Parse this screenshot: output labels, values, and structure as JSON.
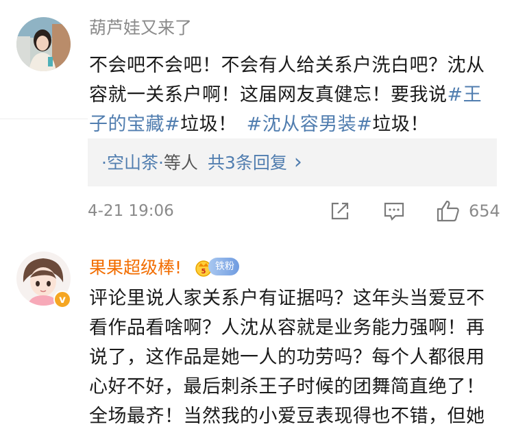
{
  "comments": [
    {
      "username": "葫芦娃又来了",
      "text_parts": [
        {
          "text": "不会吧不会吧！不会有人给关系户洗白吧？沈从容就一关系户啊！这届网友真健忘！要我说",
          "tag": false
        },
        {
          "text": "#王子的宝藏#",
          "tag": true
        },
        {
          "text": "垃圾！",
          "tag": false
        },
        {
          "text": "#沈从容男装#",
          "tag": true
        },
        {
          "text": "垃圾！",
          "tag": false
        }
      ],
      "replies": {
        "prefix": "·空山茶·",
        "middle": "等人",
        "link": "共3条回复",
        "chevron": "›"
      },
      "date": "4-21 19:06",
      "like_count": "654"
    },
    {
      "username": "果果超级棒!",
      "badge_label": "铁粉",
      "verified_mark": "v",
      "text": "评论里说人家关系户有证据吗？这年头当爱豆不看作品看啥啊？人沈从容就是业务能力强啊！再说了，这作品是她一人的功劳吗？每个人都很用心好不好，最后刺杀王子时候的团舞简直绝了！全场最齐！当然我的小爱豆表现得也不错，但她"
    }
  ],
  "icons": {
    "share": "share-icon",
    "comment": "comment-icon",
    "like": "thumbs-up-icon",
    "crown": "crown-badge-icon"
  },
  "colors": {
    "link_blue": "#507daf",
    "username_orange": "#f26d00",
    "muted_gray": "#8a8a8a",
    "reply_bg": "#f3f3f3"
  }
}
